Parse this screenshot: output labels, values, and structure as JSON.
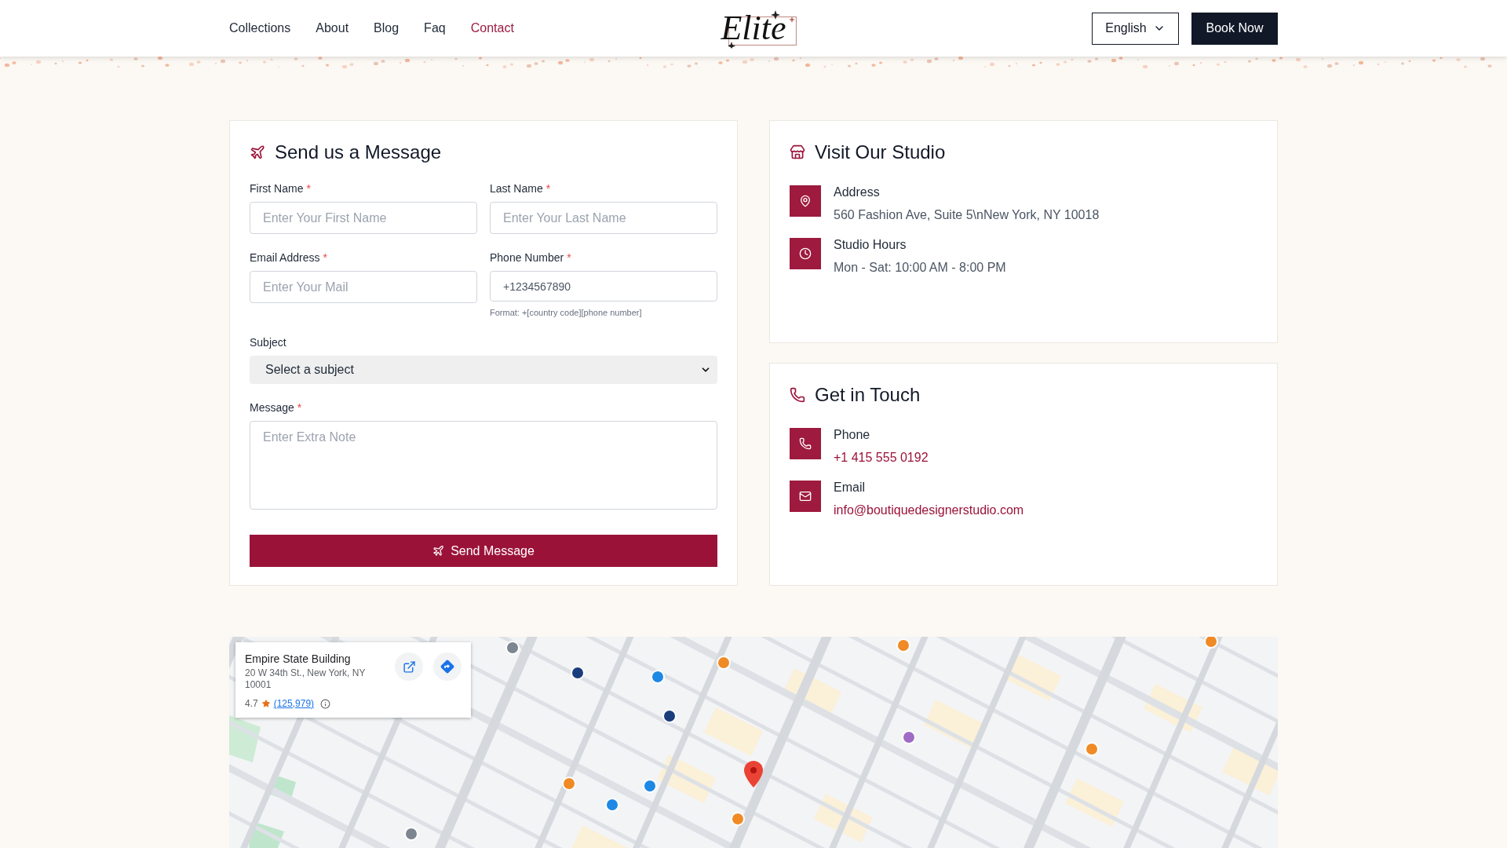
{
  "header": {
    "nav": [
      {
        "label": "Collections",
        "selected": false
      },
      {
        "label": "About",
        "selected": false
      },
      {
        "label": "Blog",
        "selected": false
      },
      {
        "label": "Faq",
        "selected": false
      },
      {
        "label": "Contact",
        "selected": true
      }
    ],
    "logo": "Elite",
    "language": "English",
    "cta": "Book Now"
  },
  "message_form": {
    "title": "Send us a Message",
    "fields": [
      {
        "kind": "input",
        "label": "First Name",
        "mark": "*",
        "placeholder": "Enter Your First Name"
      },
      {
        "kind": "input",
        "label": "Last Name",
        "mark": "*",
        "placeholder": "Enter Your Last Name"
      },
      {
        "kind": "input",
        "label": "Email Address",
        "mark": "*",
        "placeholder": "Enter Your Mail"
      },
      {
        "kind": "tel",
        "label": "Phone Number",
        "mark": "*",
        "placeholder": "+1234567890",
        "hint": "Format: +[country code][phone number]"
      },
      {
        "kind": "select",
        "label": "Subject",
        "value": "Select a subject"
      },
      {
        "kind": "textarea",
        "label": "Message",
        "mark": "*",
        "placeholder": "Enter Extra Note"
      }
    ],
    "submit": "Send Message"
  },
  "info_cards": [
    {
      "kind": "studio",
      "title": "Visit Our Studio",
      "items": [
        {
          "kind": "address",
          "label": "Address",
          "value": "560 Fashion Ave, Suite 5\\nNew York, NY 10018"
        },
        {
          "kind": "hours",
          "label": "Studio Hours",
          "value": "Mon - Sat: 10:00 AM - 8:00 PM"
        }
      ]
    },
    {
      "kind": "contact",
      "title": "Get in Touch",
      "items": [
        {
          "kind": "phone",
          "label": "Phone",
          "value": "+1 415 555 0192"
        },
        {
          "kind": "email",
          "label": "Email",
          "value": "info@boutiquedesignerstudio.com"
        }
      ]
    }
  ],
  "map": {
    "place_card": {
      "name": "Empire State Building",
      "address": "20 W 34th St., New York, NY 10001",
      "rating": "4.7",
      "reviews": "(125,979)"
    }
  }
}
